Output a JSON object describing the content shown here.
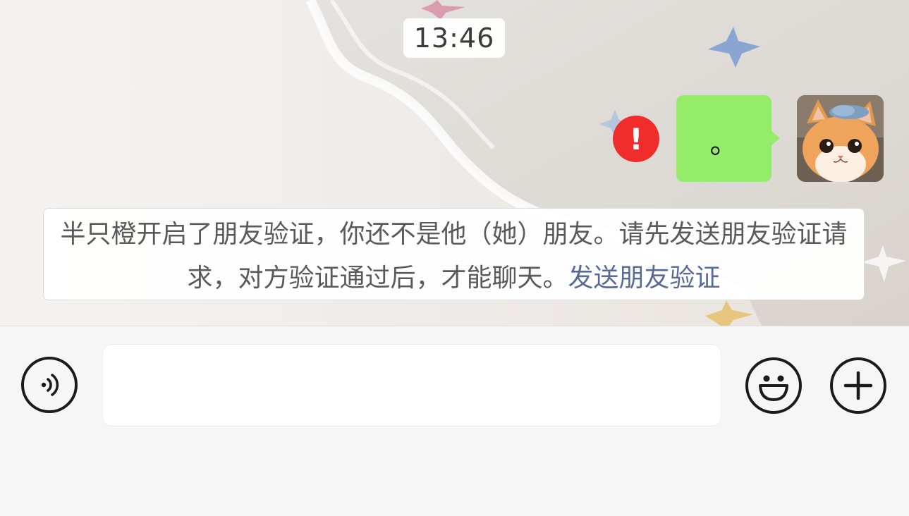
{
  "chat": {
    "timestamp": "13:46",
    "messages": [
      {
        "sender": "self",
        "text": "。",
        "status": "failed"
      }
    ],
    "notice": {
      "text": "半只橙开启了朋友验证，你还不是他（她）朋友。请先发送朋友验证请求，对方验证通过后，才能聊天。",
      "link_text": "发送朋友验证"
    }
  },
  "input_bar": {
    "input_value": "",
    "voice_icon": "voice-icon",
    "emoji_icon": "emoji-icon",
    "plus_icon": "plus-icon"
  },
  "colors": {
    "bubble_self": "#95ec69",
    "failed_badge": "#f02d2d",
    "link": "#576b95",
    "notice_text": "#5a5a5a"
  }
}
